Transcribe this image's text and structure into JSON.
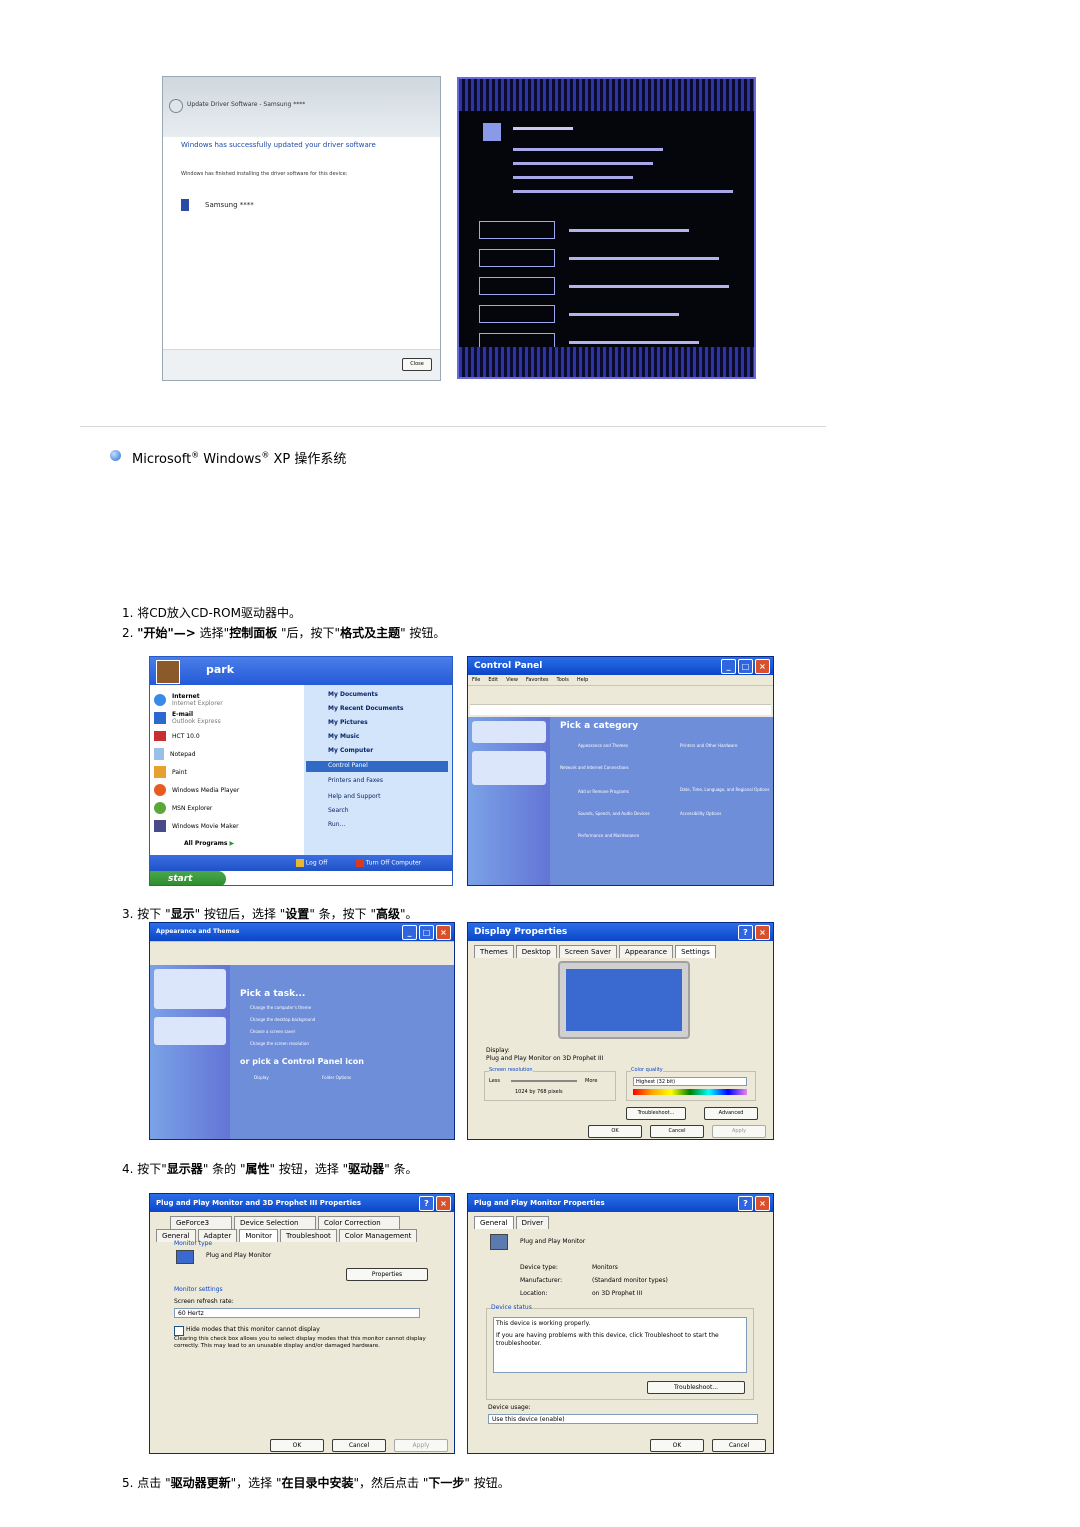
{
  "vista_dialog": {
    "title": "Update Driver Software - Samsung ****",
    "heading": "Windows has successfully updated your driver software",
    "subtext": "Windows has finished installing the driver software for this device:",
    "device": "Samsung ****",
    "close_button": "Close"
  },
  "section": {
    "title_parts": [
      "Microsoft",
      "®",
      " Windows",
      "®",
      " XP 操作系统"
    ]
  },
  "steps": {
    "s1": "1.  将CD放入CD-ROM驱动器中。",
    "s2": {
      "num": "2.",
      "a": "\"开始\"—>",
      "b": " 选择\"",
      "c": "控制面板",
      "d": " \"后，按下\"",
      "e": "格式及主题",
      "f": "\" 按钮。"
    },
    "s3": {
      "num": "3.",
      "a": " 按下 \"",
      "b": "显示",
      "c": "\" 按钮后，选择 \"",
      "d": "设置",
      "e": "\" 条，按下 \"",
      "f": "高级",
      "g": "\"。"
    },
    "s4": {
      "num": "4.",
      "a": " 按下\"",
      "b": "显示器",
      "c": "\" 条的 \"",
      "d": "属性",
      "e": "\" 按钮，选择 \"",
      "f": "驱动器",
      "g": "\" 条。"
    },
    "s5": {
      "num": "5.",
      "a": " 点击 \"",
      "b": "驱动器更新",
      "c": "\"，选择 \"",
      "d": "在目录中安装",
      "e": "\"，然后点击 \"",
      "f": "下一步",
      "g": "\" 按钮。"
    }
  },
  "start_menu": {
    "user": "park",
    "left_items": [
      "Internet",
      "Internet Explorer",
      "E-mail",
      "Outlook Express",
      "HCT 10.0",
      "Notepad",
      "Paint",
      "Windows Media Player",
      "MSN Explorer",
      "Windows Movie Maker"
    ],
    "all_programs": "All Programs",
    "right_items": [
      "My Documents",
      "My Recent Documents",
      "My Pictures",
      "My Music",
      "My Computer",
      "Control Panel",
      "Printers and Faxes",
      "Help and Support",
      "Search",
      "Run..."
    ],
    "logoff": "Log Off",
    "turnoff": "Turn Off Computer",
    "start": "start"
  },
  "control_panel": {
    "title": "Control Panel",
    "menu": [
      "File",
      "Edit",
      "View",
      "Favorites",
      "Tools",
      "Help"
    ],
    "heading": "Pick a category",
    "categories": [
      "Appearance and Themes",
      "Printers and Other Hardware",
      "Network and Internet Connections",
      "Add or Remove Programs",
      "Date, Time, Language, and Regional Options",
      "Sounds, Speech, and Audio Devices",
      "Accessibility Options",
      "Performance and Maintenance"
    ]
  },
  "appearance_window": {
    "title": "Appearance and Themes",
    "pick_task": "Pick a task...",
    "tasks": [
      "Change the computer's theme",
      "Change the desktop background",
      "Choose a screen saver",
      "Change the screen resolution"
    ],
    "pick_icon": "or pick a Control Panel icon",
    "icons": [
      "Display",
      "Folder Options"
    ]
  },
  "display_properties": {
    "title": "Display Properties",
    "tabs": [
      "Themes",
      "Desktop",
      "Screen Saver",
      "Appearance",
      "Settings"
    ],
    "display_label": "Display:",
    "display_value": "Plug and Play Monitor on 3D Prophet III",
    "resolution_label": "Screen resolution",
    "less": "Less",
    "more": "More",
    "resolution_value": "1024 by 768 pixels",
    "color_label": "Color quality",
    "color_value": "Highest (32 bit)",
    "troubleshoot": "Troubleshoot...",
    "advanced": "Advanced",
    "ok": "OK",
    "cancel": "Cancel",
    "apply": "Apply"
  },
  "monitor_props": {
    "title": "Plug and Play Monitor and 3D Prophet III Properties",
    "tabs_row1": [
      "GeForce3",
      "Device Selection",
      "Color Correction"
    ],
    "tabs_row2": [
      "General",
      "Adapter",
      "Monitor",
      "Troubleshoot",
      "Color Management"
    ],
    "monitor_type": "Monitor type",
    "monitor_name": "Plug and Play Monitor",
    "properties": "Properties",
    "monitor_settings": "Monitor settings",
    "refresh_label": "Screen refresh rate:",
    "refresh_value": "60 Hertz",
    "hide_modes": "Hide modes that this monitor cannot display",
    "hide_desc": "Clearing this check box allows you to select display modes that this monitor cannot display correctly. This may lead to an unusable display and/or damaged hardware.",
    "ok": "OK",
    "cancel": "Cancel",
    "apply": "Apply"
  },
  "pnp_props": {
    "title": "Plug and Play Monitor Properties",
    "tabs": [
      "General",
      "Driver"
    ],
    "name": "Plug and Play Monitor",
    "device_type_label": "Device type:",
    "device_type": "Monitors",
    "manufacturer_label": "Manufacturer:",
    "manufacturer": "(Standard monitor types)",
    "location_label": "Location:",
    "location": "on 3D Prophet III",
    "status_label": "Device status",
    "status_text": "This device is working properly.",
    "status_help": "If you are having problems with this device, click Troubleshoot to start the troubleshooter.",
    "troubleshoot": "Troubleshoot...",
    "usage_label": "Device usage:",
    "usage_value": "Use this device (enable)",
    "ok": "OK",
    "cancel": "Cancel"
  }
}
